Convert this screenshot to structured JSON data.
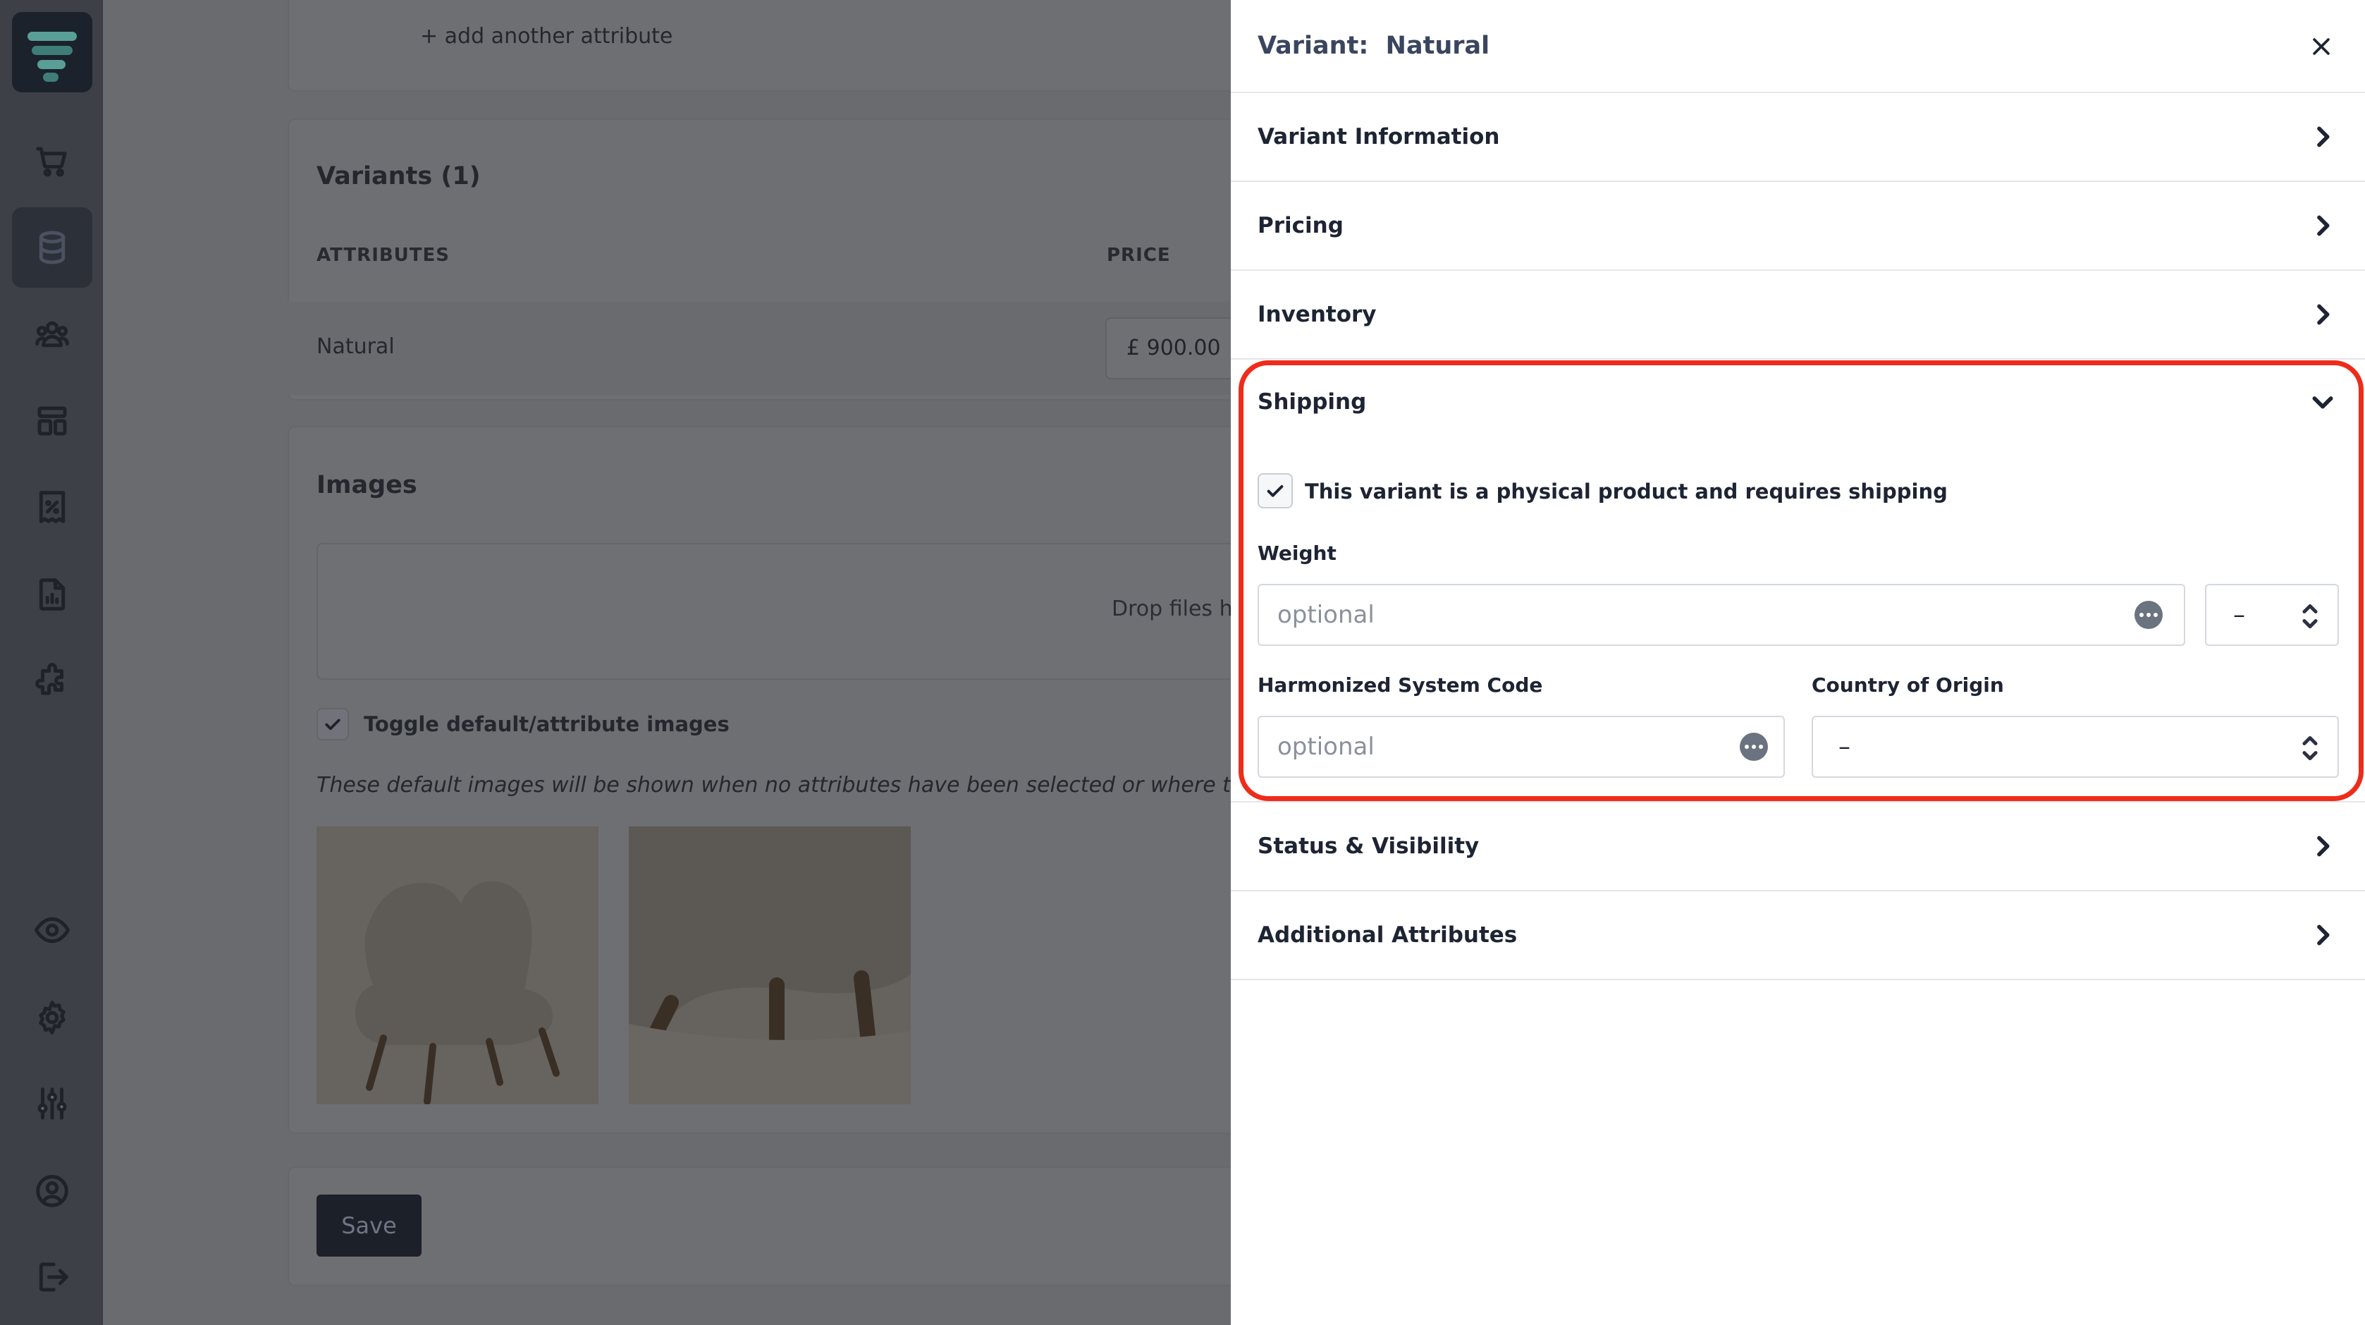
{
  "background": {
    "add_attribute_link": "+ add another attribute",
    "variants": {
      "title": "Variants (1)",
      "col_attributes": "ATTRIBUTES",
      "col_price": "PRICE",
      "row_attribute": "Natural",
      "row_price": "£ 900.00"
    },
    "images": {
      "title": "Images",
      "dropzone_text": "Drop files h",
      "toggle_label": "Toggle default/attribute images",
      "description": "These default images will be shown when no attributes have been selected or where ther"
    },
    "save_label": "Save"
  },
  "drawer": {
    "title": "Variant:  Natural",
    "sections": {
      "variant_information": "Variant Information",
      "pricing": "Pricing",
      "inventory": "Inventory",
      "shipping": "Shipping",
      "status_visibility": "Status & Visibility",
      "additional_attributes": "Additional Attributes"
    },
    "shipping": {
      "physical_checkbox_label": "This variant is a physical product and requires shipping",
      "physical_checked": true,
      "weight_label": "Weight",
      "weight_placeholder": "optional",
      "weight_unit_value": "–",
      "hs_code_label": "Harmonized System Code",
      "hs_code_placeholder": "optional",
      "country_label": "Country of Origin",
      "country_value": "–"
    }
  },
  "colors": {
    "highlight": "#ef2b1a",
    "overlay": "#6a6b6e",
    "text_primary": "#1d2433",
    "logo_teal": "#1fa79c"
  },
  "icons": [
    "logo",
    "cart-icon",
    "database-icon",
    "users-icon",
    "layout-icon",
    "discount-icon",
    "report-icon",
    "puzzle-icon",
    "eye-icon",
    "gear-icon",
    "sliders-icon",
    "user-circle-icon",
    "logout-icon",
    "close-icon",
    "chevron-right-icon",
    "chevron-down-icon",
    "check-icon",
    "more-dots-icon",
    "updown-icon"
  ]
}
